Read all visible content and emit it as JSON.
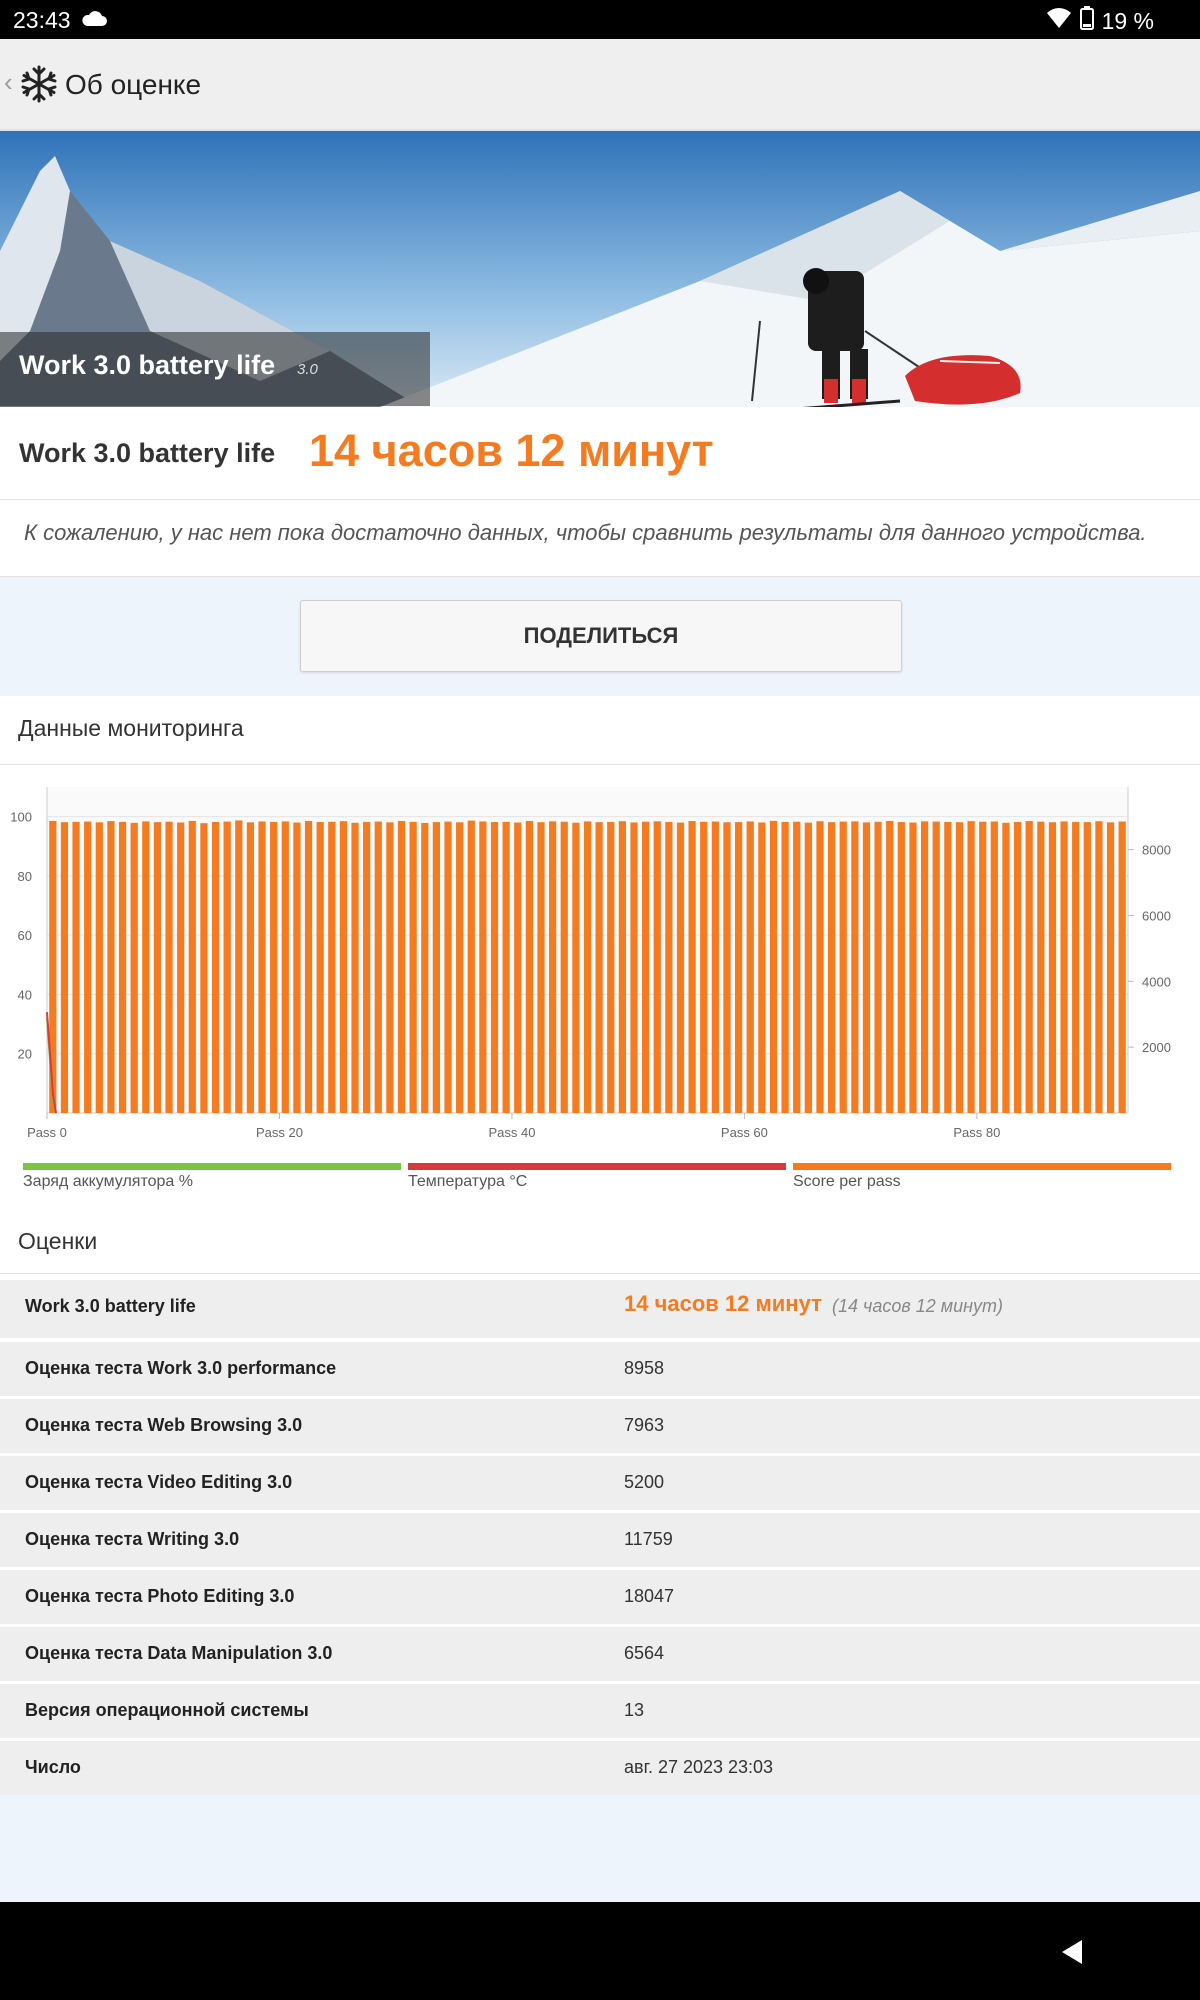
{
  "status_bar": {
    "time": "23:43",
    "battery": "19 %"
  },
  "app_bar": {
    "title": "Об оценке"
  },
  "hero": {
    "title": "Work 3.0 battery life",
    "version": "3.0"
  },
  "result": {
    "label": "Work 3.0 battery life",
    "value": "14 часов 12 минут"
  },
  "note": "К сожалению, у нас нет пока достаточно данных, чтобы сравнить результаты для данного устройства.",
  "share_button": "ПОДЕЛИТЬСЯ",
  "monitoring": {
    "title": "Данные мониторинга",
    "legend": [
      {
        "label": "Заряд аккумулятора %",
        "color": "#7cc243"
      },
      {
        "label": "Температура °C",
        "color": "#d63a3f"
      },
      {
        "label": "Score per pass",
        "color": "#f47b20"
      }
    ]
  },
  "chart_data": {
    "type": "bar",
    "left_axis": {
      "ticks": [
        "20",
        "40",
        "60",
        "80",
        "100"
      ],
      "range": [
        0,
        110
      ]
    },
    "right_axis": {
      "ticks": [
        "2000",
        "4000",
        "6000",
        "8000"
      ],
      "range": [
        0,
        9900
      ]
    },
    "x_ticks": [
      "Pass 0",
      "Pass 20",
      "Pass 40",
      "Pass 60",
      "Pass 80"
    ],
    "x_tick_positions": [
      0,
      20,
      40,
      60,
      80
    ],
    "series": [
      {
        "name": "Score per pass",
        "color": "#f47b20",
        "values": [
          8868,
          8832,
          8842,
          8851,
          8829,
          8865,
          8840,
          8811,
          8856,
          8833,
          8847,
          8822,
          8869,
          8801,
          8838,
          8850,
          8884,
          8826,
          8853,
          8840,
          8855,
          8821,
          8867,
          8836,
          8845,
          8862,
          8813,
          8839,
          8851,
          8827,
          8866,
          8843,
          8808,
          8835,
          8848,
          8829,
          8879,
          8854,
          8836,
          8842,
          8820,
          8869,
          8831,
          8857,
          8846,
          8815,
          8855,
          8833,
          8840,
          8862,
          8824,
          8847,
          8858,
          8838,
          8819,
          8866,
          8843,
          8851,
          8829,
          8835,
          8854,
          8822,
          8870,
          8840,
          8846,
          8817,
          8860,
          8832,
          8849,
          8856,
          8825,
          8843,
          8868,
          8836,
          8821,
          8857,
          8850,
          8839,
          8830,
          8863,
          8844,
          8853,
          8812,
          8838,
          8866,
          8847,
          8829,
          8855,
          8841,
          8834,
          8861,
          8826,
          8850
        ]
      },
      {
        "name": "Заряд аккумулятора %",
        "color": "#7cc243",
        "values": [
          32,
          18,
          4,
          0
        ]
      },
      {
        "name": "Температура °C",
        "color": "#d63a3f",
        "values": [
          34,
          20,
          6,
          0
        ]
      }
    ]
  },
  "scores": {
    "title": "Оценки",
    "rows": [
      {
        "label": "Work 3.0 battery life",
        "value": "14 часов 12 минут",
        "sub": "(14 часов 12 минут)"
      },
      {
        "label": "Оценка теста Work 3.0 performance",
        "value": "8958"
      },
      {
        "label": "Оценка теста Web Browsing 3.0",
        "value": "7963"
      },
      {
        "label": "Оценка теста Video Editing 3.0",
        "value": "5200"
      },
      {
        "label": "Оценка теста Writing 3.0",
        "value": "11759"
      },
      {
        "label": "Оценка теста Photo Editing 3.0",
        "value": "18047"
      },
      {
        "label": "Оценка теста Data Manipulation 3.0",
        "value": "6564"
      },
      {
        "label": "Версия операционной системы",
        "value": "13"
      },
      {
        "label": "Число",
        "value": "авг. 27 2023 23:03"
      }
    ]
  }
}
